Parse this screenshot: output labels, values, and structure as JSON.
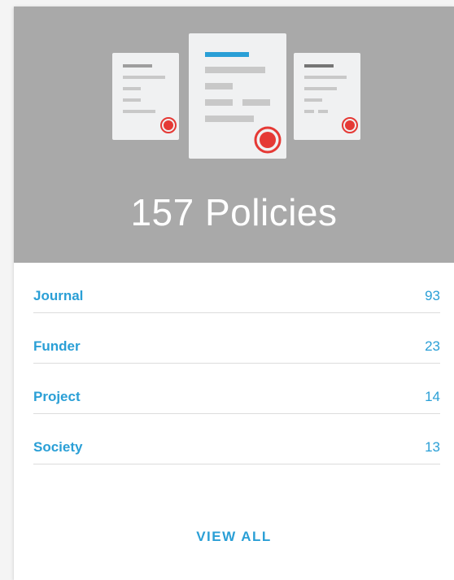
{
  "header": {
    "title": "157 Policies",
    "illustration_icon": "policy-documents-illustration"
  },
  "categories": [
    {
      "label": "Journal",
      "count": "93"
    },
    {
      "label": "Funder",
      "count": "23"
    },
    {
      "label": "Project",
      "count": "14"
    },
    {
      "label": "Society",
      "count": "13"
    }
  ],
  "footer": {
    "view_all_label": "VIEW ALL"
  },
  "colors": {
    "hero_background": "#a9a9a9",
    "accent": "#2a9fd6",
    "seal": "#e53935"
  }
}
